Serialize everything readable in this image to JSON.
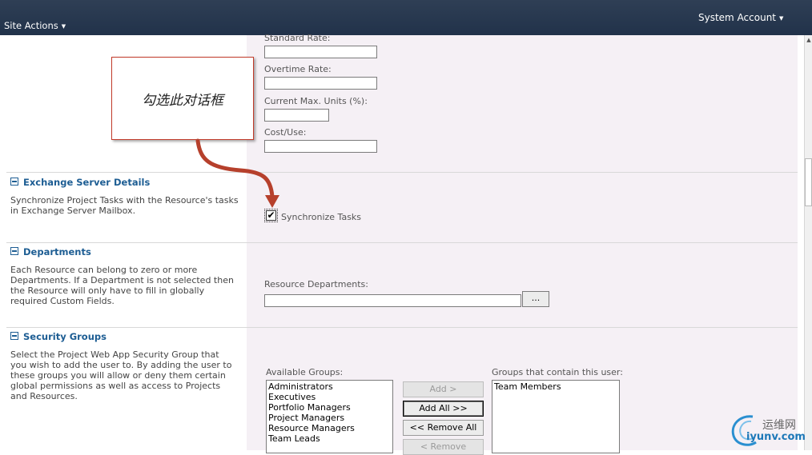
{
  "topbar": {
    "site_actions": "Site Actions",
    "account": "System Account"
  },
  "resource_info": {
    "standard_rate_label": "Standard Rate:",
    "overtime_rate_label": "Overtime Rate:",
    "current_max_units_label": "Current Max. Units (%):",
    "cost_use_label": "Cost/Use:"
  },
  "exchange": {
    "title": "Exchange Server Details",
    "description": "Synchronize Project Tasks with the Resource's tasks in Exchange Server Mailbox.",
    "checkbox_label": "Synchronize Tasks",
    "checked": true
  },
  "departments": {
    "title": "Departments",
    "description": "Each Resource can belong to zero or more Departments. If a Department is not selected then the Resource will only have to fill in globally required Custom Fields.",
    "field_label": "Resource Departments:",
    "browse_label": "..."
  },
  "security": {
    "title": "Security Groups",
    "description": "Select the Project Web App Security Group that you wish to add the user to. By adding the user to these groups you will allow or deny them certain global permissions as well as access to Projects and Resources.",
    "available_label": "Available Groups:",
    "available_groups": [
      "Administrators",
      "Executives",
      "Portfolio Managers",
      "Project Managers",
      "Resource Managers",
      "Team Leads"
    ],
    "member_label": "Groups that contain this user:",
    "member_groups": [
      "Team Members"
    ],
    "add_label": "Add >",
    "add_all_label": "Add All >>",
    "remove_all_label": "<< Remove All",
    "remove_label": "< Remove"
  },
  "annotation": {
    "callout_text": "勾选此对话框",
    "color": "#c0392b"
  },
  "watermark": {
    "top": "运维网",
    "bottom": "iyunv.com"
  }
}
